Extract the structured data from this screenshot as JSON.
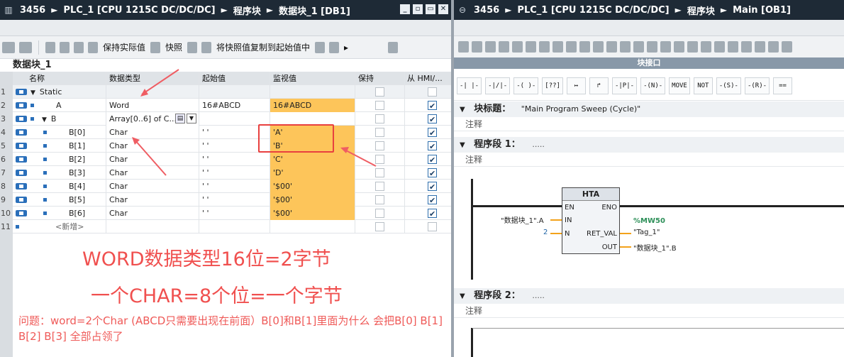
{
  "left_window": {
    "title_segments": [
      "3456",
      "PLC_1 [CPU 1215C DC/DC/DC]",
      "程序块",
      "数据块_1 [DB1]"
    ],
    "toolbar": {
      "keep_actual": "保持实际值",
      "snapshot": "快照",
      "copy_snapshot": "将快照值复制到起始值中"
    },
    "db_title": "数据块_1",
    "columns": {
      "name": "名称",
      "type": "数据类型",
      "start": "起始值",
      "monitor": "监视值",
      "retain": "保持",
      "hmi": "从 HMI/..."
    },
    "rows": [
      {
        "num": "1",
        "name": "Static",
        "type": "",
        "start": "",
        "monitor": "",
        "hmi": false
      },
      {
        "num": "2",
        "name": "A",
        "type": "Word",
        "start": "16#ABCD",
        "monitor": "16#ABCD",
        "hmi": true
      },
      {
        "num": "3",
        "name": "B",
        "type": "Array[0..6] of C...",
        "start": "",
        "monitor": "",
        "hmi": true
      },
      {
        "num": "4",
        "name": "B[0]",
        "type": "Char",
        "start": "' '",
        "monitor": "'A'",
        "hmi": true
      },
      {
        "num": "5",
        "name": "B[1]",
        "type": "Char",
        "start": "' '",
        "monitor": "'B'",
        "hmi": true
      },
      {
        "num": "6",
        "name": "B[2]",
        "type": "Char",
        "start": "' '",
        "monitor": "'C'",
        "hmi": true
      },
      {
        "num": "7",
        "name": "B[3]",
        "type": "Char",
        "start": "' '",
        "monitor": "'D'",
        "hmi": true
      },
      {
        "num": "8",
        "name": "B[4]",
        "type": "Char",
        "start": "' '",
        "monitor": "'$00'",
        "hmi": true
      },
      {
        "num": "9",
        "name": "B[5]",
        "type": "Char",
        "start": "' '",
        "monitor": "'$00'",
        "hmi": true
      },
      {
        "num": "10",
        "name": "B[6]",
        "type": "Char",
        "start": "' '",
        "monitor": "'$00'",
        "hmi": true
      },
      {
        "num": "11",
        "name": "<新增>",
        "type": "",
        "start": "",
        "monitor": "",
        "hmi": false
      }
    ],
    "annotation_line1": "WORD数据类型16位=2字节",
    "annotation_line2": "一个CHAR=8个位=一个字节",
    "question": "问题：word=2个Char (ABCD只需要出现在前面）B[0]和B[1]里面为什么 会把B[0] B[1] B[2] B[3] 全部占领了",
    "colors": {
      "monitor_fill": "#fdc55a",
      "annotation": "#f0504f",
      "titlebar": "#1e2a36"
    }
  },
  "right_window": {
    "title_segments": [
      "3456",
      "PLC_1 [CPU 1215C DC/DC/DC]",
      "程序块",
      "Main [OB1]"
    ],
    "block_interface": "块接口",
    "ladder_buttons": [
      "-| |-",
      "-|/|-",
      "-( )-",
      "[??]",
      "↦",
      "↱",
      "-|P|-",
      "-(N)-",
      "MOVE",
      "NOT",
      "-(S)-",
      "-(R)-",
      "=="
    ],
    "block_title_label": "块标题：",
    "block_title_value": "\"Main Program Sweep (Cycle)\"",
    "comment": "注释",
    "network1_label": "程序段 1：",
    "network1_dots": ".....",
    "network2_label": "程序段 2：",
    "network2_dots": ".....",
    "hta": {
      "name": "HTA",
      "en": "EN",
      "eno": "ENO",
      "in": "IN",
      "n": "N",
      "ret_val": "RET_VAL",
      "out": "OUT",
      "in_operand": "\"数据块_1\".A",
      "n_operand": "2",
      "ret_address": "%MW50",
      "ret_operand": "\"Tag_1\"",
      "out_operand": "\"数据块_1\".B"
    }
  }
}
